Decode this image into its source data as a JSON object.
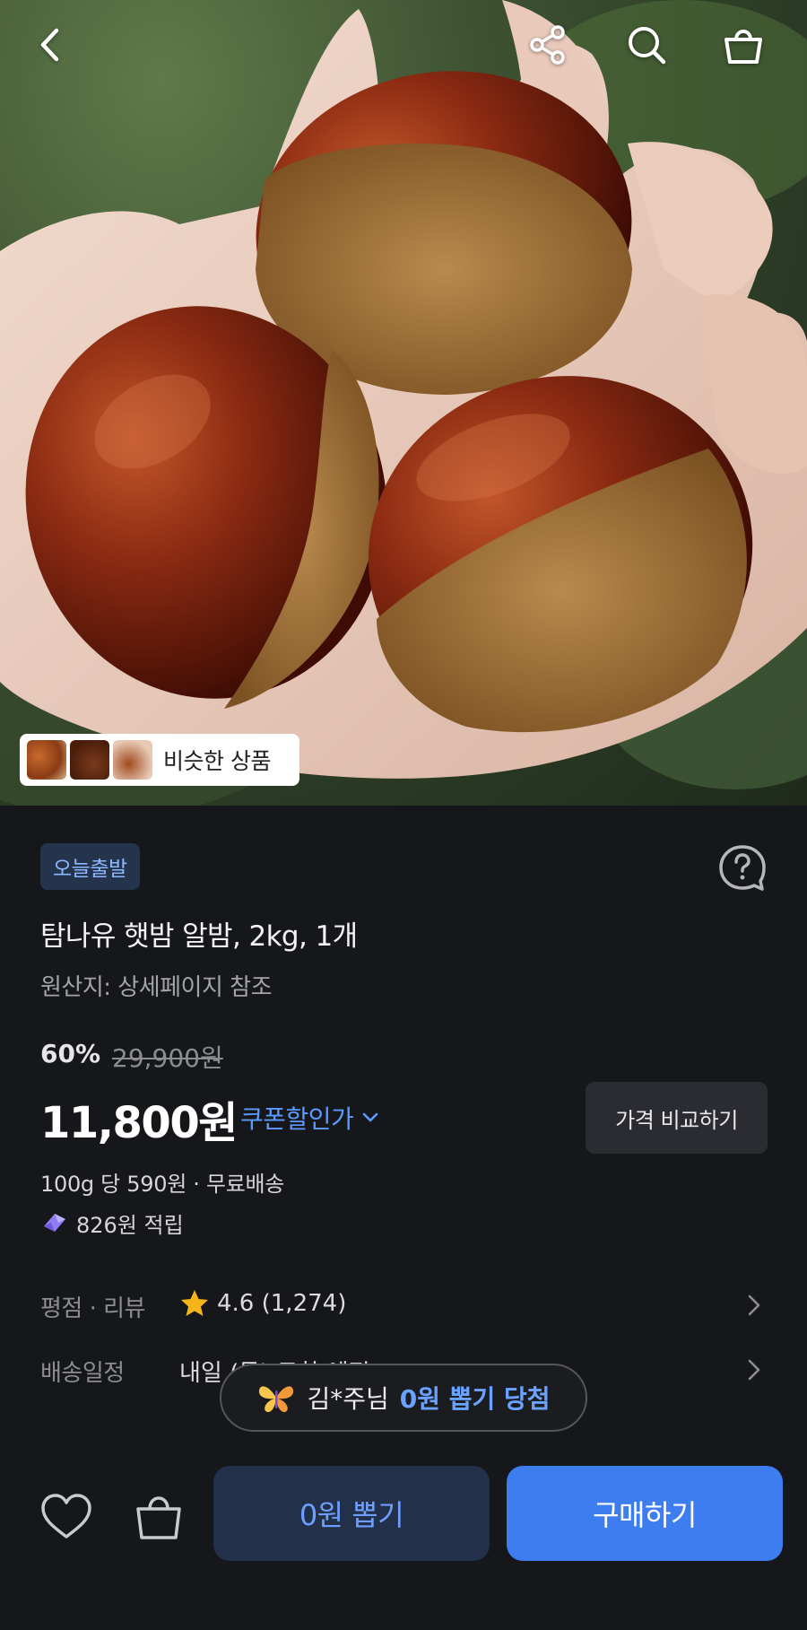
{
  "header": {
    "back_icon": "chevron-left-icon",
    "share_icon": "share-icon",
    "search_icon": "search-icon",
    "cart_icon": "shopping-bag-icon"
  },
  "similar": {
    "label": "비슷한 상품"
  },
  "product": {
    "badge": "오늘출발",
    "title": "탐나유 햇밤 알밤, 2kg, 1개",
    "origin": "원산지: 상세페이지 참조",
    "discount_rate": "60%",
    "original_price": "29,900원",
    "price": "11,800원",
    "coupon_label": "쿠폰할인가",
    "compare_label": "가격 비교하기",
    "unit_shipping": "100g 당 590원 · 무료배송",
    "points": "826원 적립"
  },
  "rows": {
    "rating_label": "평점 · 리뷰",
    "rating_value": "4.6 (1,274)",
    "delivery_label": "배송일정",
    "delivery_value": "내일 (목) 도착 예정"
  },
  "toast": {
    "name": "김*주님",
    "highlight": "0원 뽑기 당첨"
  },
  "bottom_bar": {
    "draw_label": "0원 뽑기",
    "buy_label": "구매하기"
  },
  "colors": {
    "accent_blue": "#3d7df0",
    "badge_text": "#8db8ff",
    "star": "#f5b418",
    "background": "#16171b"
  }
}
